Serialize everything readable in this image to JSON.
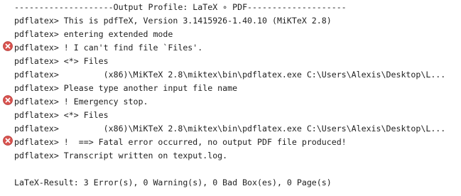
{
  "console": {
    "lines": [
      {
        "text": "--------------------Output Profile: LaTeX ∘ PDF--------------------",
        "error": false
      },
      {
        "text": "pdflatex> This is pdfTeX, Version 3.1415926-1.40.10 (MiKTeX 2.8)",
        "error": false
      },
      {
        "text": "pdflatex> entering extended mode",
        "error": false
      },
      {
        "text": "pdflatex> ! I can't find file `Files'.",
        "error": true
      },
      {
        "text": "pdflatex> <*> Files",
        "error": false
      },
      {
        "text": "pdflatex>         (x86)\\MiKTeX 2.8\\miktex\\bin\\pdflatex.exe C:\\Users\\Alexis\\Desktop\\L...",
        "error": false
      },
      {
        "text": "pdflatex> Please type another input file name",
        "error": false
      },
      {
        "text": "pdflatex> ! Emergency stop.",
        "error": true
      },
      {
        "text": "pdflatex> <*> Files",
        "error": false
      },
      {
        "text": "pdflatex>         (x86)\\MiKTeX 2.8\\miktex\\bin\\pdflatex.exe C:\\Users\\Alexis\\Desktop\\L...",
        "error": false
      },
      {
        "text": "pdflatex> !  ==> Fatal error occurred, no output PDF file produced!",
        "error": true
      },
      {
        "text": "pdflatex> Transcript written on texput.log.",
        "error": false
      },
      {
        "text": "",
        "error": false
      },
      {
        "text": "LaTeX-Result: 3 Error(s), 0 Warning(s), 0 Bad Box(es), 0 Page(s)",
        "error": false
      }
    ]
  },
  "icons": {
    "error": "error-circle-x-icon"
  },
  "colors": {
    "text": "#1e1e1e",
    "error_icon": "#d9534f",
    "background": "#ffffff"
  }
}
